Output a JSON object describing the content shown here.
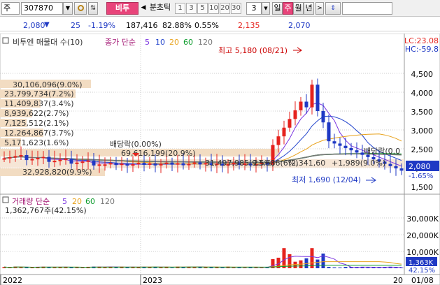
{
  "toolbar": {
    "market": "주",
    "code": "307870",
    "tab_name": "비투",
    "toggle": "분초틱",
    "periods": [
      "1",
      "3",
      "5",
      "10",
      "20",
      "30"
    ],
    "count": "3",
    "chart_type": "일",
    "weekly": "주",
    "monthly": "월",
    "yearly": "년"
  },
  "quote": {
    "price": "2,080",
    "change": "25",
    "rate": "-1.19%",
    "volume": "187,416",
    "vol_ratio": "82.88%",
    "turnover": "0.55%",
    "high": "2,135",
    "low": "2,070"
  },
  "price_panel": {
    "title": "비투엔 매물대 수(10)",
    "ma_label": "종가 단순",
    "ma_periods": [
      "5",
      "10",
      "20",
      "60",
      "120"
    ],
    "lc": "LC:23.08",
    "hc": "HC:-59.8",
    "y_ticks": [
      "4,500",
      "4,000",
      "3,500",
      "3,000",
      "2,500",
      "2,000",
      "1,500"
    ],
    "volume_profile": [
      "30,106,096(9.0%)",
      "23,799,734(7.2%)",
      "11,409,837(3.4%)",
      "8,939,622(2.7%)",
      "7,125,512(2.1%)",
      "12,264,867(3.7%)",
      "5,171,623(1.6%)",
      "69,616,199(20.9%)",
      "32,928,820(9.9%)",
      "31,497,985(9.5%)",
      "23,686(6%)",
      "(2,341,60",
      "+1,989(9.0%)"
    ],
    "dividend": "배당락(0.00%)",
    "dividend_right": "배당락(0.0",
    "high_note": "최고 5,180 (08/21)",
    "low_note": "최저 1,690 (12/04)",
    "cur_price": "2,080",
    "cur_rate": "-1.65%"
  },
  "volume_panel": {
    "title": "거래량 단순",
    "ma_periods": [
      "5",
      "20",
      "60",
      "120"
    ],
    "value": "1,362,767주(42.15%)",
    "y_ticks": [
      "30,000K",
      "20,000K",
      "10,000K"
    ],
    "cur": "1,363K",
    "cur_pct": "42.15%"
  },
  "x_axis": {
    "labels": [
      "2022",
      "2023",
      "20",
      "01/08"
    ]
  },
  "colors": {
    "up": "#e5221d",
    "down": "#1f39c4",
    "ma5": "#7a34e0",
    "ma10": "#2244cc",
    "ma20": "#e8a21c",
    "ma60": "#0a9a2a",
    "ma120": "#777777"
  }
}
